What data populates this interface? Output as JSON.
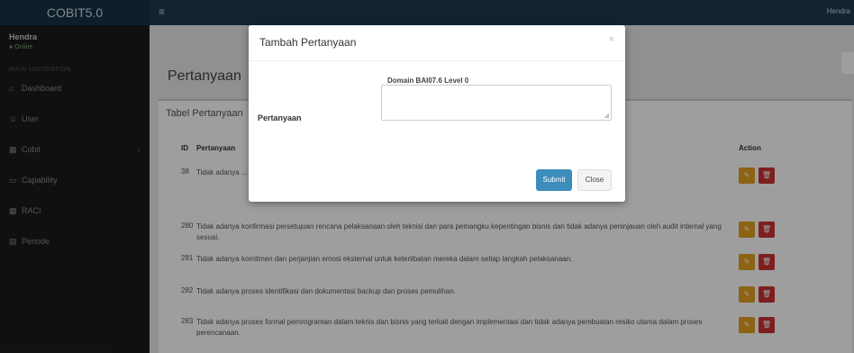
{
  "app": {
    "logo": "COBIT5.0",
    "menu_toggle": "≡",
    "user_top": "Hendra"
  },
  "sidebar": {
    "user_name": "Hendra",
    "user_status": "● Online",
    "nav_header": "MAIN NAVIGATION",
    "items": [
      {
        "icon": "dashboard-icon",
        "glyph": "⌂",
        "label": "Dashboard"
      },
      {
        "icon": "users-icon",
        "glyph": "☺",
        "label": "User"
      },
      {
        "icon": "table-icon",
        "glyph": "▦",
        "label": "Cobit",
        "chevron": "‹"
      },
      {
        "icon": "laptop-icon",
        "glyph": "▭",
        "label": "Capability"
      },
      {
        "icon": "table-icon",
        "glyph": "▦",
        "label": "RACI"
      },
      {
        "icon": "calendar-icon",
        "glyph": "▤",
        "label": "Periode"
      }
    ]
  },
  "page": {
    "title": "Pertanyaan"
  },
  "table": {
    "title": "Tabel Pertanyaan",
    "headers": {
      "id": "ID",
      "question": "Pertanyaan",
      "action": "Action"
    },
    "rows": [
      {
        "id": "38",
        "text": "Tidak adanya ... implementasi, kebutuhan sumber d... instalasi, strategi te..."
      },
      {
        "id": "280",
        "text": "Tidak adanya konfirmasi persetujuan rencana pelaksanaan oleh teknisi dan para pemangku kepentingan bisnis dan tidak adanya peninjauan oleh audit internal yang sesuai."
      },
      {
        "id": "281",
        "text": "Tidak adanya komitmen dan perjanjian emosi eksternal untuk keterlibatan mereka dalam setiap langkah pelaksanaan."
      },
      {
        "id": "282",
        "text": "Tidak adanya proses identifikasi dan dokumentasi backup dan proses pemulihan."
      },
      {
        "id": "283",
        "text": "Tidak adanya proses formal pemrograman dalam teknis dan bisnis yang terkait dengan implementasi dan tidak adanya pembuatan resiko utama dalam proses perencanaan."
      }
    ]
  },
  "modal": {
    "title": "Tambah Pertanyaan",
    "close": "×",
    "domain_line": "Domain BAI07.6 Level 0",
    "field_label": "Pertanyaan",
    "textarea_value": "",
    "submit": "Submit",
    "close_btn": "Close"
  },
  "colors": {
    "submit": "#3c8dbc",
    "edit": "#e0a020",
    "delete": "#cc3333",
    "topbar": "#1e3a52"
  }
}
